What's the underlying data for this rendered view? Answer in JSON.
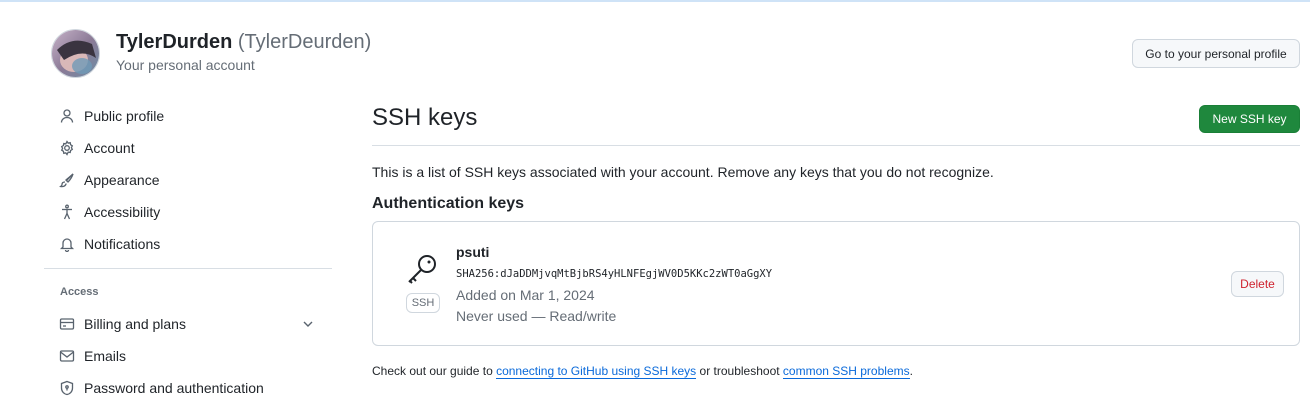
{
  "header": {
    "display_name": "TylerDurden",
    "handle": "(TylerDeurden)",
    "subtitle": "Your personal account",
    "profile_button": "Go to your personal profile"
  },
  "sidebar": {
    "items": [
      {
        "label": "Public profile",
        "icon": "person-icon"
      },
      {
        "label": "Account",
        "icon": "gear-icon"
      },
      {
        "label": "Appearance",
        "icon": "paintbrush-icon"
      },
      {
        "label": "Accessibility",
        "icon": "accessibility-icon"
      },
      {
        "label": "Notifications",
        "icon": "bell-icon"
      }
    ],
    "access_heading": "Access",
    "access_items": [
      {
        "label": "Billing and plans",
        "icon": "credit-card-icon"
      },
      {
        "label": "Emails",
        "icon": "mail-icon"
      },
      {
        "label": "Password and authentication",
        "icon": "shield-lock-icon"
      }
    ]
  },
  "main": {
    "title": "SSH keys",
    "new_button": "New SSH key",
    "description": "This is a list of SSH keys associated with your account. Remove any keys that you do not recognize.",
    "auth_heading": "Authentication keys",
    "key": {
      "title": "psuti",
      "fingerprint": "SHA256:dJaDDMjvqMtBjbRS4yHLNFEgjWV0D5KKc2zWT0aGgXY",
      "added": "Added on Mar 1, 2024",
      "usage": "Never used — Read/write",
      "badge": "SSH",
      "delete_button": "Delete"
    },
    "footer": {
      "prefix": "Check out our guide to ",
      "link1": "connecting to GitHub using SSH keys",
      "middle": " or troubleshoot ",
      "link2": "common SSH problems",
      "suffix": "."
    }
  },
  "colors": {
    "primary_green": "#1f883d",
    "link_blue": "#0969da",
    "danger_red": "#cf222e",
    "muted_text": "#656d76",
    "border": "#d0d7de"
  }
}
